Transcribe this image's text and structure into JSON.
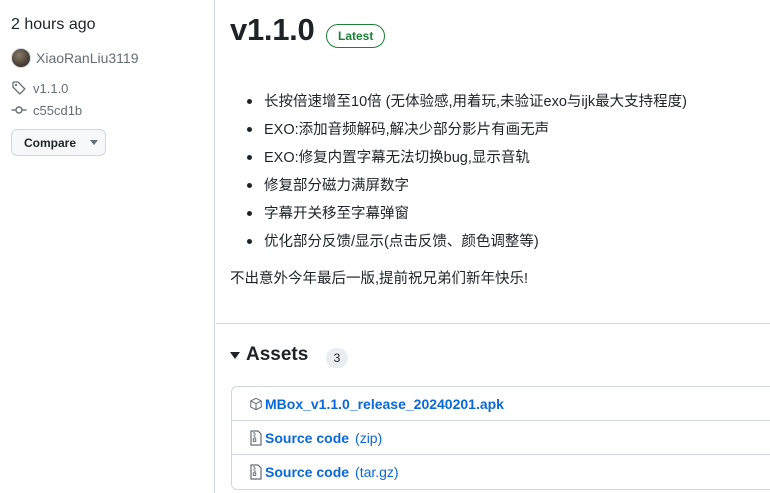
{
  "sidebar": {
    "time": "2 hours ago",
    "author": "XiaoRanLiu3119",
    "tag": "v1.1.0",
    "commit": "c55cd1b",
    "compare_label": "Compare"
  },
  "release": {
    "title": "v1.1.0",
    "badge": "Latest",
    "notes": [
      "长按倍速增至10倍 (无体验感,用着玩,未验证exo与ijk最大支持程度)",
      "EXO:添加音频解码,解决少部分影片有画无声",
      "EXO:修复内置字幕无法切换bug,显示音轨",
      "修复部分磁力满屏数字",
      "字幕开关移至字幕弹窗",
      "优化部分反馈/显示(点击反馈、颜色调整等)"
    ],
    "closing": "不出意外今年最后一版,提前祝兄弟们新年快乐!"
  },
  "assets": {
    "title": "Assets",
    "count": "3",
    "items": [
      {
        "name": "MBox_v1.1.0_release_20240201.apk",
        "ext": "",
        "icon": "package-icon"
      },
      {
        "name": "Source code",
        "ext": "(zip)",
        "icon": "file-zip-icon"
      },
      {
        "name": "Source code",
        "ext": "(tar.gz)",
        "icon": "file-zip-icon"
      }
    ]
  },
  "colors": {
    "accent_link": "#0969da",
    "latest_green": "#1a7f37",
    "border": "#d0d7de"
  }
}
